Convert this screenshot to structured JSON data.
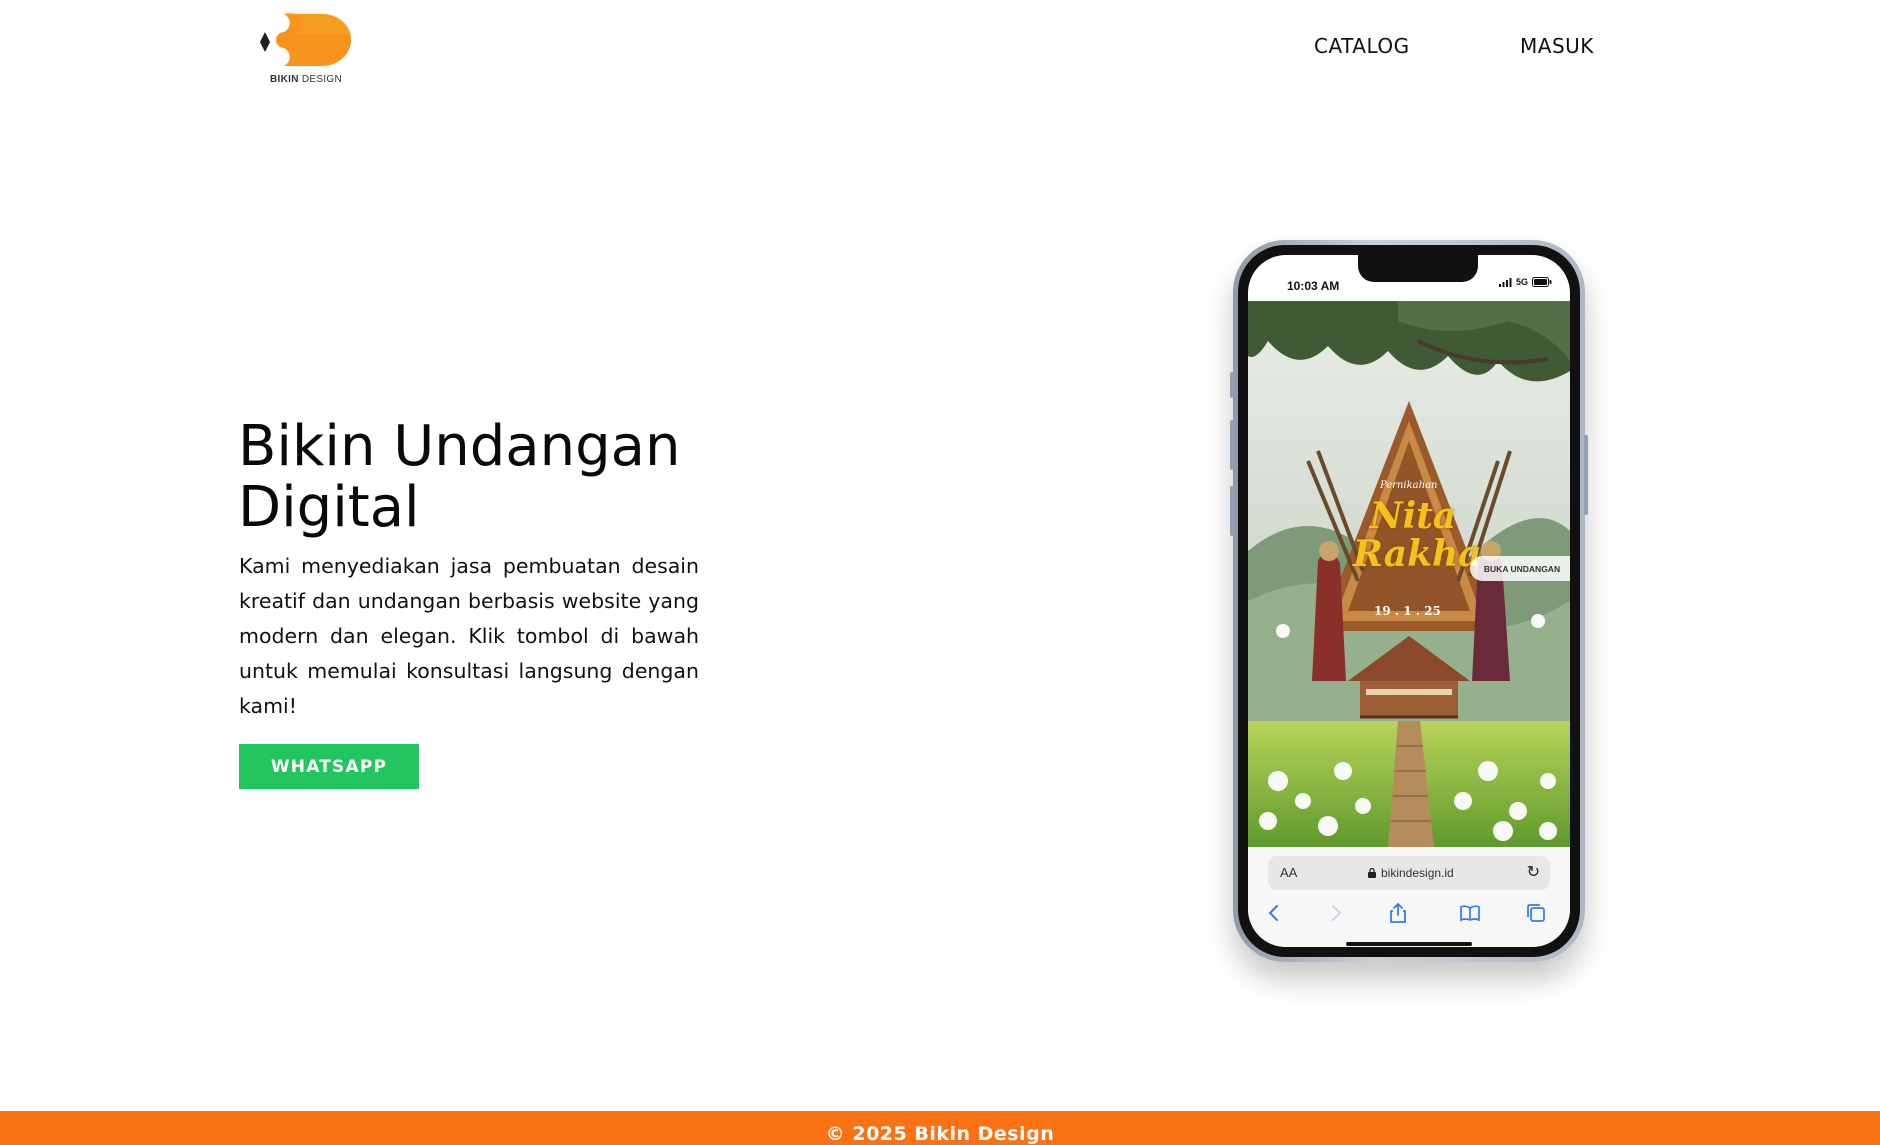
{
  "colors": {
    "brand_orange": "#f97316",
    "logo_orange": "#f7941d",
    "whatsapp_green": "#22c55e",
    "text_dark": "#111111"
  },
  "header": {
    "logo": {
      "brand_bold": "BIKIN",
      "brand_regular": "DESIGN",
      "icon": "bikin-design-logo"
    },
    "nav": [
      {
        "label": "CATALOG"
      },
      {
        "label": "MASUK"
      }
    ]
  },
  "hero": {
    "title": "Bikin Undangan Digital",
    "description": "Kami menyediakan jasa pembuatan desain kreatif dan undangan berbasis website yang modern dan elegan. Klik tombol di bawah untuk memulai konsultasi langsung dengan kami!",
    "cta_label": "WHATSAPP"
  },
  "phone": {
    "status_time": "10:03 AM",
    "status_network": "5G",
    "invitation": {
      "subtitle": "Pernikahan",
      "names": [
        "Nita",
        "Rakha"
      ],
      "date": "19 . 1 . 25",
      "open_button": "BUKA UNDANGAN"
    },
    "browser": {
      "text_size_label": "AA",
      "url": "bikindesign.id",
      "icons": [
        "back-icon",
        "forward-icon",
        "share-icon",
        "bookmarks-icon",
        "tabs-icon"
      ]
    }
  },
  "footer": {
    "copyright": "© 2025 Bikin Design"
  }
}
